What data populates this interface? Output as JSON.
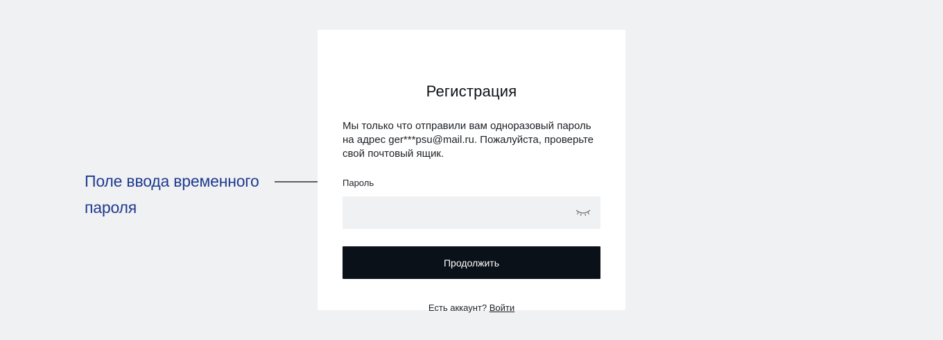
{
  "card": {
    "title": "Регистрация",
    "message": "Мы только что отправили вам одноразовый пароль на адрес ger***psu@mail.ru. Пожалуйста, проверьте свой почтовый ящик.",
    "password_label": "Пароль",
    "password_value": "",
    "password_toggle_icon": "eye-closed-icon",
    "continue_label": "Продолжить",
    "login_prompt": "Есть аккаунт?",
    "login_link": "Войти"
  },
  "annotation": {
    "text": "Поле ввода временного пароля",
    "color": "#1e3a8f"
  },
  "colors": {
    "background": "#f0f1f3",
    "card": "#ffffff",
    "button": "#0b1118",
    "input": "#f0f1f3"
  }
}
